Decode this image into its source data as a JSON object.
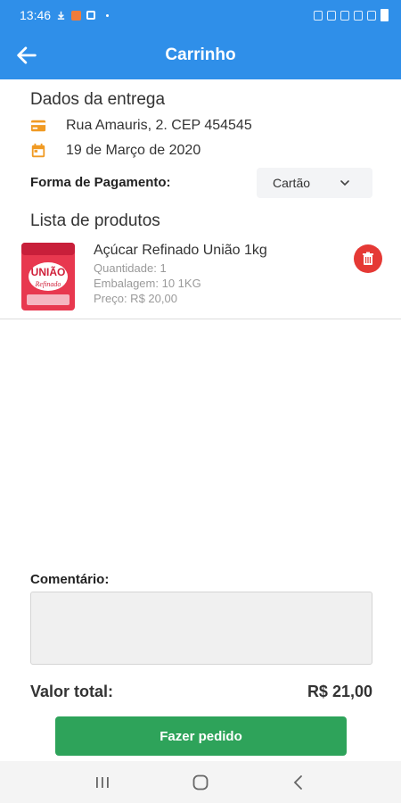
{
  "status_bar": {
    "time": "13:46",
    "icons": [
      "download-icon",
      "app-notification-icon",
      "check-icon",
      "dot-icon",
      "alarm-icon",
      "mute-icon",
      "wifi-icon",
      "signal-icon",
      "signal-icon",
      "battery-icon"
    ]
  },
  "app_bar": {
    "title": "Carrinho",
    "back_icon": "arrow-left-icon"
  },
  "delivery": {
    "heading": "Dados da entrega",
    "address": "Rua Amauris, 2. CEP 454545",
    "date": "19 de Março de 2020",
    "address_icon": "card-icon",
    "date_icon": "calendar-icon",
    "icon_color": "#f09a23"
  },
  "payment": {
    "label": "Forma de Pagamento:",
    "selected": "Cartão"
  },
  "products": {
    "heading": "Lista de produtos",
    "items": [
      {
        "name": "Açúcar Refinado União 1kg",
        "quantity": "Quantidade: 1",
        "packaging": "Embalagem: 10 1KG",
        "price": "Preço: R$ 20,00",
        "image_brand": "UNIÃO",
        "image_subtitle": "Refinado"
      }
    ]
  },
  "comment": {
    "label": "Comentário:",
    "value": ""
  },
  "total": {
    "label": "Valor total:",
    "value": "R$ 21,00"
  },
  "order_button": {
    "label": "Fazer pedido"
  },
  "colors": {
    "primary": "#2f8fe9",
    "button": "#2ea35a",
    "delete": "#e53935"
  }
}
